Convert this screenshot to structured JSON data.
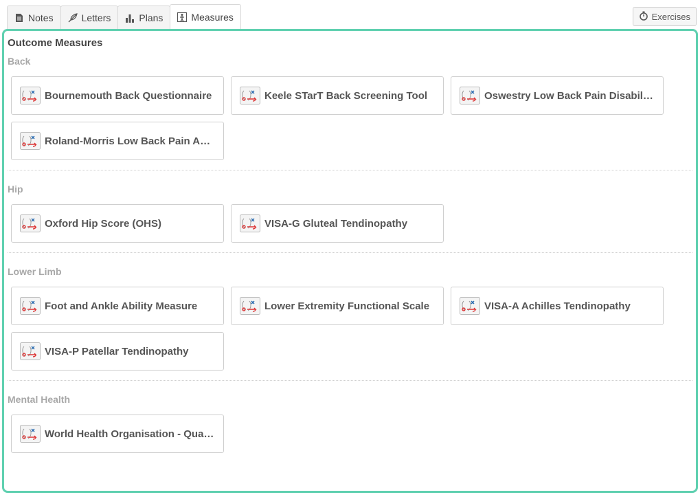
{
  "tabs": [
    {
      "label": "Notes",
      "icon": "document-icon"
    },
    {
      "label": "Letters",
      "icon": "feather-icon"
    },
    {
      "label": "Plans",
      "icon": "bar-chart-icon"
    },
    {
      "label": "Measures",
      "icon": "measures-icon",
      "active": true
    }
  ],
  "exercises_button": {
    "label": "Exercises",
    "icon": "stopwatch-icon"
  },
  "panel": {
    "title": "Outcome Measures",
    "accent_color": "#5fd0b0",
    "sections": [
      {
        "title": "Back",
        "items": [
          "Bournemouth Back Questionnaire",
          "Keele STarT Back Screening Tool",
          "Oswestry Low Back Pain Disability…",
          "Roland-Morris Low Back Pain And …"
        ]
      },
      {
        "title": "Hip",
        "items": [
          "Oxford Hip Score (OHS)",
          "VISA-G Gluteal Tendinopathy"
        ]
      },
      {
        "title": "Lower Limb",
        "items": [
          "Foot and Ankle Ability Measure",
          "Lower Extremity Functional Scale",
          "VISA-A Achilles Tendinopathy",
          "VISA-P Patellar Tendinopathy"
        ]
      },
      {
        "title": "Mental Health",
        "items": [
          "World Health Organisation - Quali…"
        ]
      }
    ]
  }
}
